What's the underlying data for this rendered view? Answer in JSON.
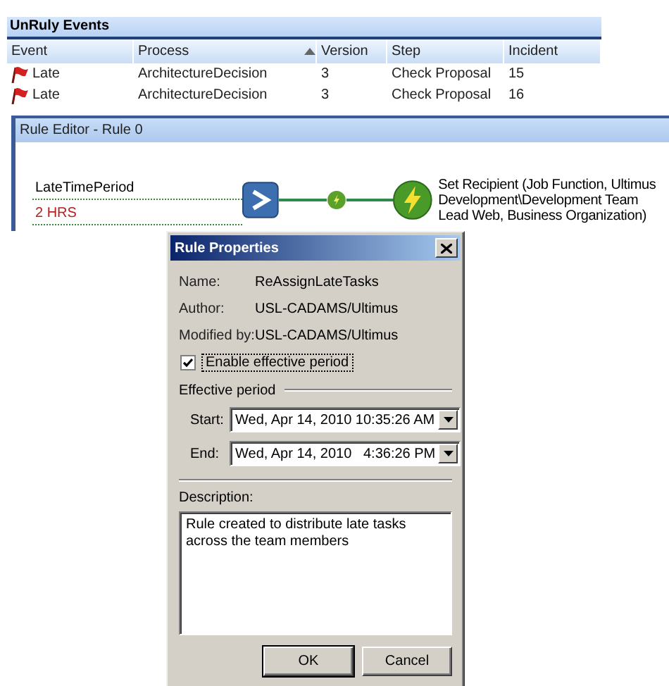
{
  "events_panel": {
    "title": "UnRuly Events",
    "columns": [
      {
        "label": "Event",
        "sorted": false
      },
      {
        "label": "Process",
        "sorted": true
      },
      {
        "label": "Version",
        "sorted": false
      },
      {
        "label": "Step",
        "sorted": false
      },
      {
        "label": "Incident",
        "sorted": false
      }
    ],
    "rows": [
      {
        "event": "Late",
        "process": "ArchitectureDecision",
        "version": "3",
        "step": "Check Proposal",
        "incident": "15"
      },
      {
        "event": "Late",
        "process": "ArchitectureDecision",
        "version": "3",
        "step": "Check Proposal",
        "incident": "16"
      }
    ]
  },
  "rule_editor": {
    "title": "Rule Editor - Rule 0",
    "condition": {
      "name": "LateTimePeriod",
      "value": "2 HRS"
    },
    "action": "Set Recipient (Job Function, Ultimus Development\\Development Team Lead Web, Business Organization)"
  },
  "dialog": {
    "title": "Rule Properties",
    "fields": [
      {
        "label": "Name:",
        "value": "ReAssignLateTasks"
      },
      {
        "label": "Author:",
        "value": "USL-CADAMS/Ultimus"
      },
      {
        "label": "Modified by:",
        "value": "USL-CADAMS/Ultimus"
      }
    ],
    "enable_checkbox": {
      "label": "Enable effective period",
      "checked": true
    },
    "effective_period": {
      "label": "Effective period",
      "start": {
        "label": "Start:",
        "value": "Wed, Apr 14, 2010 10:35:26 AM"
      },
      "end": {
        "label": "End:",
        "value": "Wed, Apr 14, 2010   4:36:26 PM"
      }
    },
    "description": {
      "label": "Description:",
      "value": "Rule created to distribute late tasks across the team members"
    },
    "buttons": [
      "OK",
      "Cancel"
    ]
  }
}
